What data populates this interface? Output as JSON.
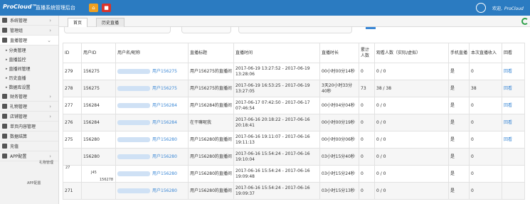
{
  "header": {
    "logo": "ProCloud™",
    "title": "直播系统管理后台",
    "btn_orange_label": "⌂",
    "btn_red_label": "■",
    "welcome": "欢迎,",
    "username": "ProCloud"
  },
  "sidebar": {
    "items": [
      {
        "label": "系统管理",
        "icon": "settings-icon"
      },
      {
        "label": "管理组",
        "icon": "monitor-icon"
      },
      {
        "label": "直播管理",
        "icon": "video-icon"
      }
    ],
    "sub_items": [
      {
        "label": "分类管理"
      },
      {
        "label": "直播监控"
      },
      {
        "label": "直播间管理"
      },
      {
        "label": "历史直播"
      },
      {
        "label": "数据库设置"
      }
    ],
    "items_lower": [
      {
        "label": "财务管理",
        "icon": "yen-icon"
      },
      {
        "label": "礼物管理",
        "icon": "gift-icon"
      },
      {
        "label": "店铺管理",
        "icon": "shop-icon"
      },
      {
        "label": "单页内容管理",
        "icon": "page-icon"
      },
      {
        "label": "数据结算",
        "icon": "chart-icon"
      },
      {
        "label": "充值",
        "icon": "coin-icon"
      },
      {
        "label": "APP配置",
        "icon": "gear-icon"
      }
    ],
    "ghost_1": "礼物管理",
    "ghost_2": "APP配置"
  },
  "tabs": [
    {
      "label": "首页"
    },
    {
      "label": "历史直播"
    }
  ],
  "table": {
    "headers": [
      "ID",
      "用户ID",
      "用户名/昵称",
      "直播标题",
      "直播时间",
      "直播时长",
      "累计人数",
      "观看人数（实际/虚拟）",
      "手机直播",
      "本次直播收入",
      "回看"
    ],
    "rows": [
      {
        "id": "279",
        "uid": "156275",
        "nick": "用户156275",
        "title": "用户156275的直播间",
        "time": "2017-06-19 13:27:52 - 2017-06-19 13:28:06",
        "duration": "00小时00分14秒",
        "total": "0",
        "viewers": "0 / 0",
        "mobile": "是",
        "income": "0",
        "replay": "回看"
      },
      {
        "id": "278",
        "uid": "156275",
        "nick": "用户156275",
        "title": "用户156275的直播间",
        "time": "2017-06-19 16:53:25 - 2017-06-19 13:27:05",
        "duration": "3天20小时33分40秒",
        "total": "73",
        "viewers": "38 / 38",
        "mobile": "是",
        "income": "38",
        "replay": "回看"
      },
      {
        "id": "277",
        "uid": "156284",
        "nick": "用户156284",
        "title": "用户156284的直播间",
        "time": "2017-06-17 07:42:50 - 2017-06-17 07:46:54",
        "duration": "00小时04分04秒",
        "total": "0",
        "viewers": "0 / 0",
        "mobile": "是",
        "income": "0",
        "replay": "回看"
      },
      {
        "id": "276",
        "uid": "156284",
        "nick": "用户156284",
        "title": "在干嘛呢我",
        "time": "2017-06-16 20:18:22 - 2017-06-16 20:18:41",
        "duration": "00小时00分19秒",
        "total": "0",
        "viewers": "0 / 0",
        "mobile": "是",
        "income": "0",
        "replay": "回看"
      },
      {
        "id": "275",
        "uid": "156280",
        "nick": "用户156280",
        "title": "用户156280的直播间",
        "time": "2017-06-16 19:11:07 - 2017-06-16 19:11:13",
        "duration": "00小时00分06秒",
        "total": "0",
        "viewers": "0 / 0",
        "mobile": "是",
        "income": "0",
        "replay": "回看"
      },
      {
        "id": "",
        "uid": "156280",
        "nick": "用户156280",
        "title": "用户156280的直播间",
        "time": "2017-06-16 15:54:24 - 2017-06-16 19:10:04",
        "duration": "03小时15分40秒",
        "total": "0",
        "viewers": "0 / 0",
        "mobile": "是",
        "income": "0",
        "replay": ""
      },
      {
        "id": "",
        "uid": "",
        "nick": "用户156280",
        "title": "用户156280的直播间",
        "time": "2017-06-16 15:54:24 - 2017-06-16 19:09:48",
        "duration": "03小时15分24秒",
        "total": "0",
        "viewers": "0 / 0",
        "mobile": "是",
        "income": "0",
        "replay": ""
      },
      {
        "id": "271",
        "uid": "",
        "nick": "用户156280",
        "title": "用户156280的直播间",
        "time": "2017-06-16 15:54:24 - 2017-06-16 19:09:37",
        "duration": "03小时15分13秒",
        "total": "0",
        "viewers": "0 / 0",
        "mobile": "是",
        "income": "0",
        "replay": ""
      }
    ],
    "ghost_ids": [
      "27",
      "J45",
      "156278"
    ]
  },
  "colors": {
    "header_bg": "#2b7bc1",
    "link": "#3a87d5",
    "refresh": "#2ea04a"
  }
}
